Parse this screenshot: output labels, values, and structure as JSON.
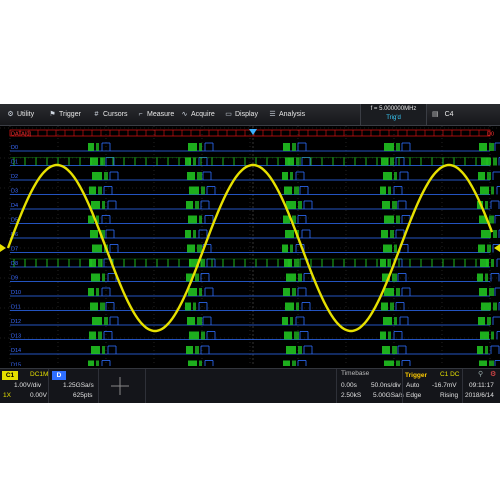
{
  "menu": {
    "utility": "Utility",
    "trigger": "Trigger",
    "cursors": "Cursors",
    "measure": "Measure",
    "acquire": "Acquire",
    "display": "Display",
    "analysis": "Analysis"
  },
  "status": {
    "frequency": "f = 5.000000MHz",
    "trig_state": "Trig'd",
    "channel": "C4"
  },
  "digital_channels": [
    "D0",
    "D1",
    "D2",
    "D3",
    "D4",
    "D5",
    "D6",
    "D7",
    "D8",
    "D9",
    "D10",
    "D11",
    "D12",
    "D13",
    "D14",
    "D15"
  ],
  "bus_label": "DATA[0]",
  "bus_right_label": "D0",
  "ch1": {
    "badge": "C1",
    "coupling": "DC1M",
    "scale": "1.00V/div",
    "probe": "1X",
    "offset": "0.00V"
  },
  "digital": {
    "badge": "D",
    "sample_rate": "1.25GSa/s",
    "points": "625pts"
  },
  "timebase": {
    "header": "Timebase",
    "delay": "0.00s",
    "scale": "50.0ns/div",
    "memory": "2.50kS",
    "sample_rate": "5.00GSa/s"
  },
  "trigger": {
    "header": "Trigger",
    "source": "C1 DC",
    "mode": "Auto",
    "level": "-16.7mV",
    "type": "Edge",
    "slope": "Rising"
  },
  "clock": {
    "time": "09:11:17",
    "date": "2018/6/14"
  },
  "colors": {
    "ch1": "#e6e000",
    "digital_high": "#22cc22",
    "digital_low": "#2f6fff",
    "bus": "#cc1111",
    "trigger_marker": "#3ab0ff"
  }
}
